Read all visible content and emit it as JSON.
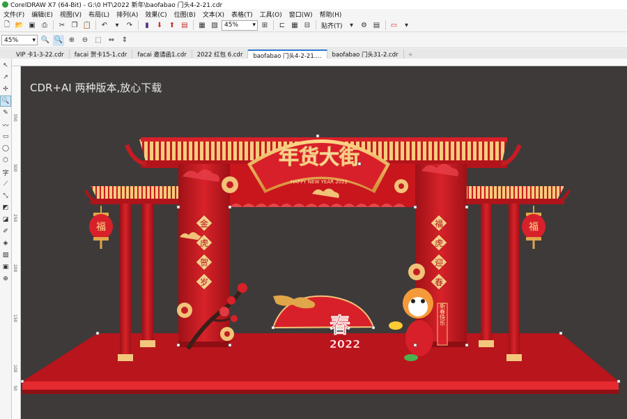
{
  "window": {
    "title": "CorelDRAW X7 (64-Bit) - G:\\0 HT\\2022 新年\\baofabao 门头4-2-21.cdr"
  },
  "menu": [
    "文件(F)",
    "编辑(E)",
    "视图(V)",
    "布局(L)",
    "排列(A)",
    "效果(C)",
    "位图(B)",
    "文本(X)",
    "表格(T)",
    "工具(O)",
    "窗口(W)",
    "帮助(H)"
  ],
  "toolbar": {
    "zoom_value": "45%",
    "snap_label": "贴齐(T)"
  },
  "propertybar": {
    "zoom_value": "45%"
  },
  "tabs": [
    "VIP 卡1-3-22.cdr",
    "facai 贺卡15-1.cdr",
    "facai 邀请函1.cdr",
    "2022 红包 6.cdr",
    "baofabao 门头4-2-21....",
    "baofabao 门头31-2.cdr"
  ],
  "active_tab": 4,
  "ruler": {
    "v_labels": [
      "350",
      "300",
      "250",
      "200",
      "150",
      "100",
      "50"
    ]
  },
  "canvas": {
    "note": "CDR+AI 两种版本,放心下载",
    "artwork": {
      "banner_title": "年货大街",
      "banner_subtitle": "HAPPY NEW YEAR 2022",
      "left_couplet": [
        "金",
        "虎",
        "贺",
        "岁"
      ],
      "right_couplet": [
        "福",
        "虎",
        "迎",
        "春"
      ],
      "lantern_char": "福",
      "spring_char": "春",
      "year_text": "2022",
      "scroll_text": "新春快乐"
    }
  },
  "colors": {
    "canvas_bg": "#3e3a3a",
    "red": "#d01c20",
    "dark_red": "#a8151a",
    "gold": "#f4c67a"
  }
}
